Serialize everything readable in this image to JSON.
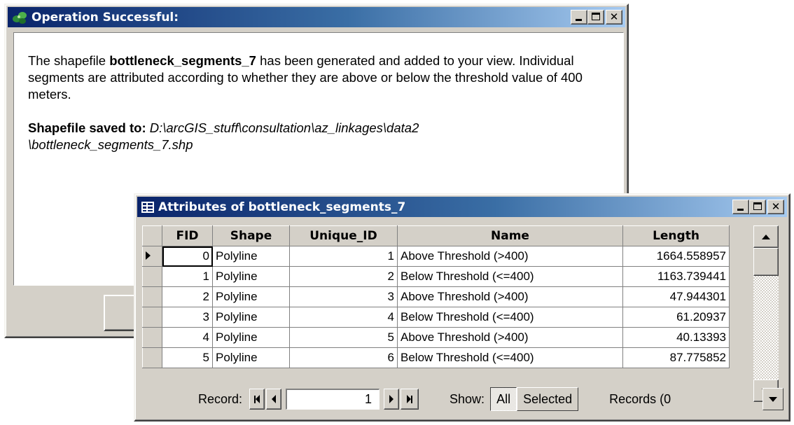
{
  "dialog": {
    "title": "Operation Successful:",
    "msg_part1": "The shapefile ",
    "shapefile_name": "bottleneck_segments_7",
    "msg_part2": " has been generated and added to your view.  Individual segments are attributed according to whether they are above or below the threshold value of 400 meters.",
    "saved_label": "Shapefile saved to:",
    "saved_path_line1": "D:\\arcGIS_stuff\\consultation\\az_linkages\\data2",
    "saved_path_line2": "\\bottleneck_segments_7.shp"
  },
  "attr_window": {
    "title": "Attributes of bottleneck_segments_7",
    "columns": [
      "FID",
      "Shape",
      "Unique_ID",
      "Name",
      "Length"
    ],
    "rows": [
      [
        "0",
        "Polyline",
        "1",
        "Above Threshold (>400)",
        "1664.558957"
      ],
      [
        "1",
        "Polyline",
        "2",
        "Below Threshold (<=400)",
        "1163.739441"
      ],
      [
        "2",
        "Polyline",
        "3",
        "Above Threshold (>400)",
        "47.944301"
      ],
      [
        "3",
        "Polyline",
        "4",
        "Below Threshold (<=400)",
        "61.20937"
      ],
      [
        "4",
        "Polyline",
        "5",
        "Above Threshold (>400)",
        "40.13393"
      ],
      [
        "5",
        "Polyline",
        "6",
        "Below Threshold (<=400)",
        "87.775852"
      ]
    ],
    "nav": {
      "record_label": "Record:",
      "record_value": "1",
      "show_label": "Show:",
      "all_label": "All",
      "selected_label": "Selected",
      "records_label": "Records (0"
    }
  },
  "caption_buttons": {
    "close_glyph": "✕"
  },
  "colors": {
    "titlebar_start": "#0a246a",
    "titlebar_end": "#a6caf0",
    "face": "#d4d0c8"
  }
}
